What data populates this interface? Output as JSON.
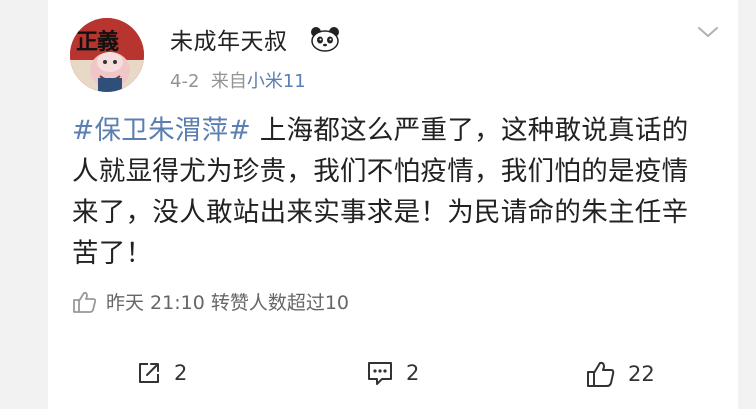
{
  "post": {
    "username": "未成年天叔",
    "username_badge": "panda-icon",
    "avatar_text": "正義",
    "date": "4-2",
    "source_prefix": "来自",
    "source_device": "小米11",
    "hashtag": "#保卫朱渭萍#",
    "body": " 上海都这么严重了，这种敢说真话的人就显得尤为珍贵，我们不怕疫情，我们怕的是疫情来了，没人敢站出来实事求是！为民请命的朱主任辛苦了！",
    "stats_text": "昨天 21:10 转赞人数超过10"
  },
  "actions": {
    "repost_count": "2",
    "comment_count": "2",
    "like_count": "22"
  },
  "colors": {
    "link": "#5b7fb0",
    "meta": "#939393",
    "text": "#222222",
    "background": "#f2f2f2"
  }
}
